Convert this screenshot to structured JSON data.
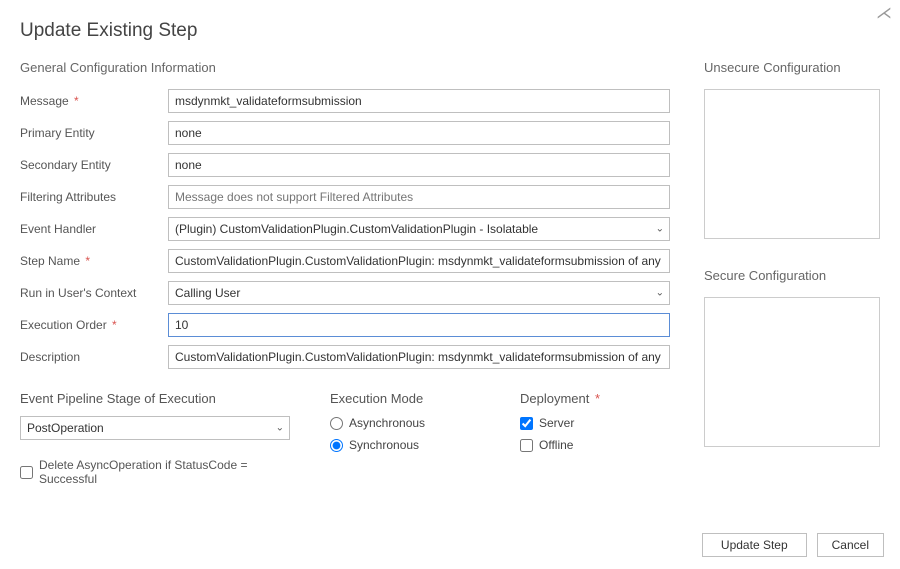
{
  "title": "Update Existing Step",
  "general": {
    "heading": "General Configuration Information",
    "message": {
      "label": "Message",
      "value": "msdynmkt_validateformsubmission"
    },
    "primaryEntity": {
      "label": "Primary Entity",
      "value": "none"
    },
    "secondaryEntity": {
      "label": "Secondary Entity",
      "value": "none"
    },
    "filteringAttributes": {
      "label": "Filtering Attributes",
      "placeholder": "Message does not support Filtered Attributes"
    },
    "eventHandler": {
      "label": "Event Handler",
      "value": "(Plugin) CustomValidationPlugin.CustomValidationPlugin - Isolatable"
    },
    "stepName": {
      "label": "Step Name",
      "value": "CustomValidationPlugin.CustomValidationPlugin: msdynmkt_validateformsubmission of any Ent"
    },
    "runAs": {
      "label": "Run in User's Context",
      "value": "Calling User"
    },
    "executionOrder": {
      "label": "Execution Order",
      "value": "10"
    },
    "description": {
      "label": "Description",
      "value": "CustomValidationPlugin.CustomValidationPlugin: msdynmkt_validateformsubmission of any Ent"
    }
  },
  "pipeline": {
    "heading": "Event Pipeline Stage of Execution",
    "value": "PostOperation"
  },
  "executionMode": {
    "heading": "Execution Mode",
    "asynchronous": "Asynchronous",
    "synchronous": "Synchronous",
    "selected": "synchronous"
  },
  "deployment": {
    "heading": "Deployment",
    "server": "Server",
    "offline": "Offline",
    "serverChecked": true,
    "offlineChecked": false
  },
  "deleteAsync": {
    "label": "Delete AsyncOperation if StatusCode = Successful",
    "checked": false
  },
  "unsecure": {
    "heading": "Unsecure  Configuration",
    "value": ""
  },
  "secure": {
    "heading": "Secure  Configuration",
    "value": ""
  },
  "buttons": {
    "update": "Update Step",
    "cancel": "Cancel"
  }
}
